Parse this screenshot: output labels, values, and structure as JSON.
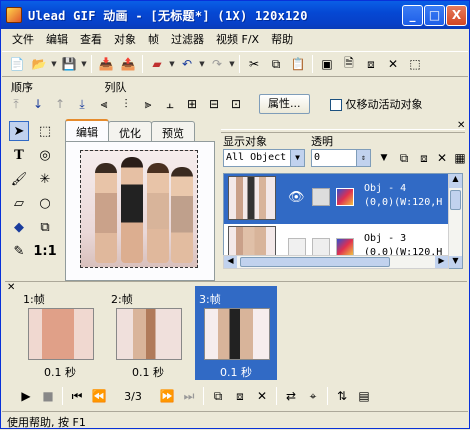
{
  "window": {
    "title": "Ulead GIF 动画 - [无标题*] (1X) 120x120",
    "minimize": "_",
    "maximize": "□",
    "close": "X"
  },
  "menu": [
    "文件",
    "编辑",
    "查看",
    "对象",
    "帧",
    "过滤器",
    "视频 F/X",
    "帮助"
  ],
  "labels": {
    "order": "顺序",
    "arrange": "列队"
  },
  "toolbar2": {
    "properties_button": "属性...",
    "move_active_only": "仅移动活动对象"
  },
  "editor": {
    "tabs": [
      "编辑",
      "优化",
      "预览"
    ],
    "active_tab": "编辑"
  },
  "objects_panel": {
    "display_label": "显示对象",
    "display_value": "All Object",
    "opacity_label": "透明",
    "opacity_value": "0",
    "items": [
      {
        "name": "Obj - 4",
        "info": "(0,0)(W:120,H",
        "selected": true
      },
      {
        "name": "Obj - 3",
        "info": "(0,0)(W:120,H",
        "selected": false
      }
    ]
  },
  "frames": [
    {
      "label": "1:帧",
      "delay": "0.1 秒",
      "selected": false
    },
    {
      "label": "2:帧",
      "delay": "0.1 秒",
      "selected": false
    },
    {
      "label": "3:帧",
      "delay": "0.1 秒",
      "selected": true
    }
  ],
  "playback": {
    "counter": "3/3"
  },
  "status": "使用帮助, 按 F1"
}
